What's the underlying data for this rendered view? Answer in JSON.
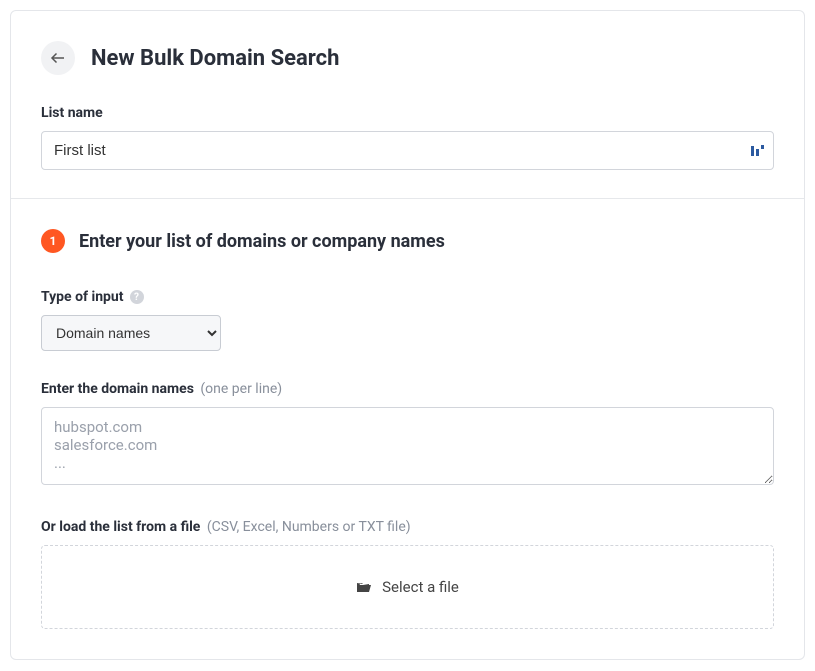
{
  "header": {
    "title": "New Bulk Domain Search",
    "listNameLabel": "List name",
    "listNameValue": "First list"
  },
  "step": {
    "number": "1",
    "title": "Enter your list of domains or company names"
  },
  "inputType": {
    "label": "Type of input",
    "selected": "Domain names"
  },
  "domains": {
    "label": "Enter the domain names",
    "hint": "(one per line)",
    "placeholder": "hubspot.com\nsalesforce.com\n..."
  },
  "fileLoad": {
    "label": "Or load the list from a file",
    "hint": "(CSV, Excel, Numbers or TXT file)",
    "buttonText": "Select a file"
  }
}
